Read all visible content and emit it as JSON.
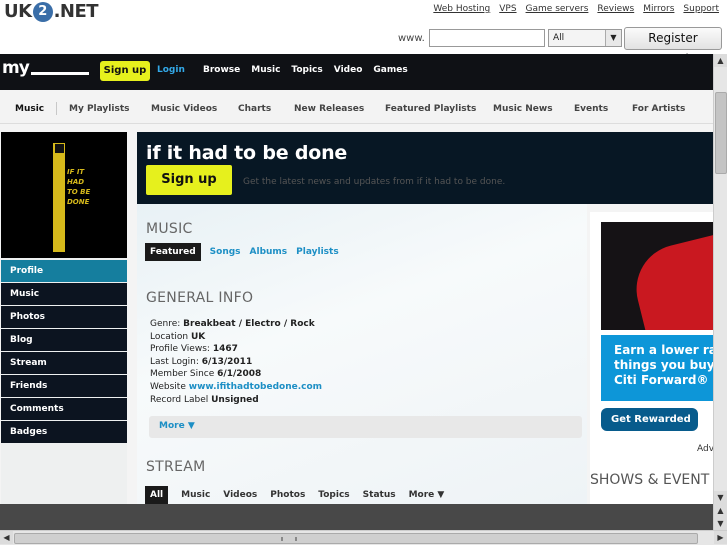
{
  "uk2": {
    "logo_pre": "UK",
    "logo_num": "2",
    "logo_post": ".NET",
    "links": [
      "Web Hosting",
      "VPS",
      "Game servers",
      "Reviews",
      "Mirrors",
      "Support"
    ],
    "www_label": "www.",
    "domain_value": "",
    "tld_value": "All",
    "register_label": "Register Domain"
  },
  "mynav": {
    "logo": "my",
    "signup": "Sign up",
    "login": "Login",
    "items": [
      "Browse",
      "Music",
      "Topics",
      "Video",
      "Games"
    ]
  },
  "subnav": {
    "items": [
      "Music",
      "My Playlists",
      "Music Videos",
      "Charts",
      "New Releases",
      "Featured Playlists",
      "Music News",
      "Events",
      "For Artists"
    ]
  },
  "artist": {
    "image_text": "IF IT HAD TO BE DONE",
    "name": "if it had to be done",
    "signup": "Sign up",
    "tagline": "Get the latest news and updates from if it had to be done."
  },
  "profile_menu": [
    "Profile",
    "Music",
    "Photos",
    "Blog",
    "Stream",
    "Friends",
    "Comments",
    "Badges"
  ],
  "music": {
    "heading": "MUSIC",
    "tabs": [
      "Featured",
      "Songs",
      "Albums",
      "Playlists"
    ]
  },
  "info": {
    "heading": "GENERAL INFO",
    "genre_label": "Genre:",
    "genre_value": "Breakbeat / Electro / Rock",
    "location_label": "Location",
    "location_value": "UK",
    "views_label": "Profile Views:",
    "views_value": "1467",
    "login_label": "Last Login:",
    "login_value": "6/13/2011",
    "member_label": "Member Since",
    "member_value": "6/1/2008",
    "website_label": "Website",
    "website_value": "www.ifithadtobedone.com",
    "label_label": "Record Label",
    "label_value": "Unsigned",
    "more": "More ▼"
  },
  "stream": {
    "heading": "STREAM",
    "tabs": [
      "All",
      "Music",
      "Videos",
      "Photos",
      "Topics",
      "Status",
      "More ▼"
    ]
  },
  "ad": {
    "line1": "Earn a lower ra",
    "line2": "things you buy",
    "line3": "Citi Forward® ca",
    "cta": "Get Rewarded ▸",
    "label": "Adv"
  },
  "shows_heading": "SHOWS & EVENT",
  "icons": [
    "chevron-down-icon",
    "scroll-up-icon",
    "scroll-down-icon",
    "scroll-left-icon",
    "scroll-right-icon"
  ]
}
